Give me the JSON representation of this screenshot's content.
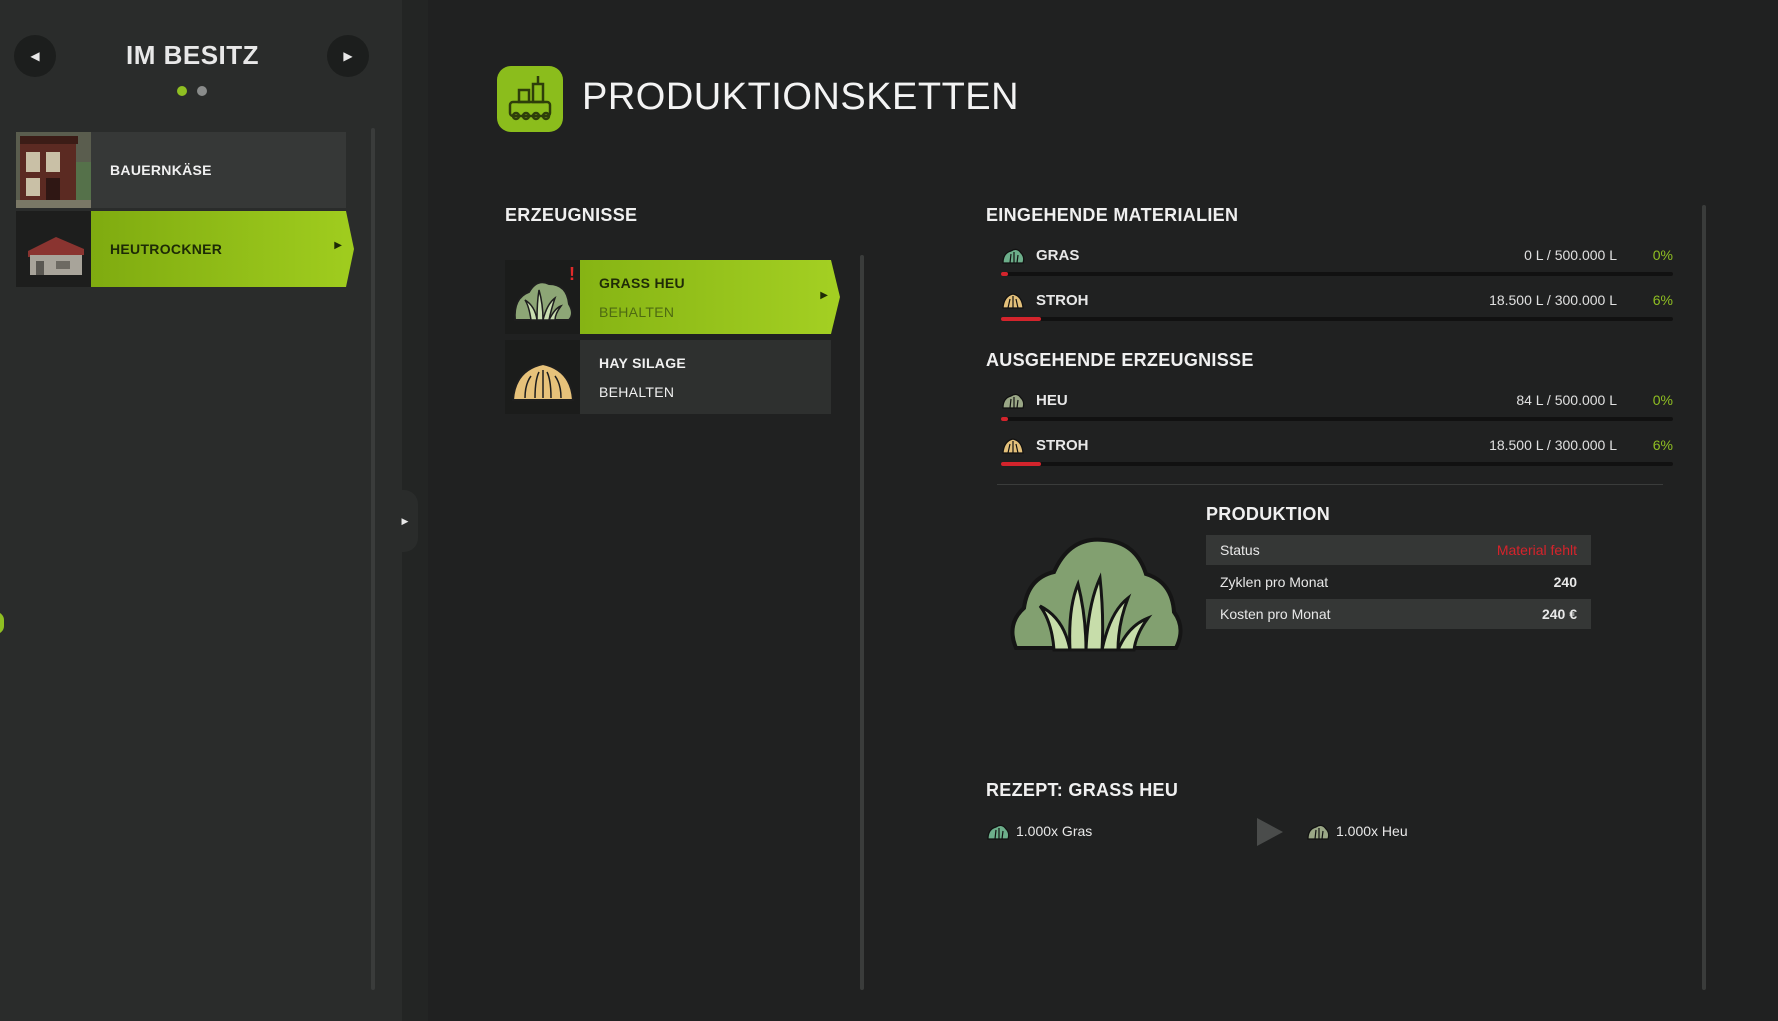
{
  "sidebar": {
    "title": "IM BESITZ",
    "prev_icon": "triangle-left-icon",
    "next_icon": "triangle-right-icon",
    "pages": 2,
    "active_page": 1,
    "items": [
      {
        "label": "BAUERNKÄSE",
        "selected": false
      },
      {
        "label": "HEUTROCKNER",
        "selected": true
      }
    ]
  },
  "header": {
    "title": "PRODUKTIONSKETTEN",
    "icon": "production-factory-icon"
  },
  "products": {
    "heading": "ERZEUGNISSE",
    "items": [
      {
        "name": "GRASS HEU",
        "mode": "BEHALTEN",
        "selected": true,
        "warning": "!"
      },
      {
        "name": "HAY SILAGE",
        "mode": "BEHALTEN",
        "selected": false
      }
    ]
  },
  "incoming": {
    "heading": "EINGEHENDE MATERIALIEN",
    "rows": [
      {
        "name": "GRAS",
        "value": "0 L / 500.000 L",
        "percent": "0%",
        "fill": 0.0
      },
      {
        "name": "STROH",
        "value": "18.500 L / 300.000 L",
        "percent": "6%",
        "fill": 0.06
      }
    ]
  },
  "outgoing": {
    "heading": "AUSGEHENDE ERZEUGNISSE",
    "rows": [
      {
        "name": "HEU",
        "value": "84 L / 500.000 L",
        "percent": "0%",
        "fill": 0.0
      },
      {
        "name": "STROH",
        "value": "18.500 L / 300.000 L",
        "percent": "6%",
        "fill": 0.06
      }
    ]
  },
  "production": {
    "heading": "PRODUKTION",
    "status_label": "Status",
    "status_value": "Material fehlt",
    "cycles_label": "Zyklen pro Monat",
    "cycles_value": "240",
    "cost_label": "Kosten pro Monat",
    "cost_value": "240 €"
  },
  "recipe": {
    "heading": "REZEPT: GRASS HEU",
    "input": "1.000x Gras",
    "output": "1.000x Heu"
  },
  "colors": {
    "accent": "#8fbf22",
    "warning": "#d6232b",
    "background": "#202121",
    "sidebar": "#2a2c2b"
  }
}
